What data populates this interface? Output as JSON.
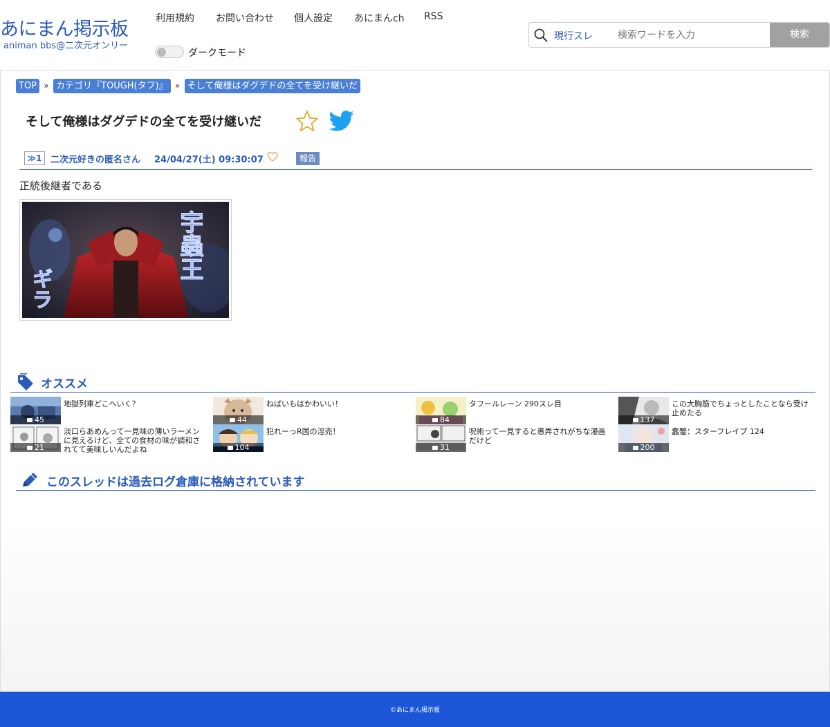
{
  "header": {
    "logo_main": "あにまん掲示板",
    "logo_sub": "animan bbs@二次元オンリー",
    "nav": [
      "利用規約",
      "お問い合わせ",
      "個人設定",
      "あにまんch",
      "RSS"
    ],
    "dark_mode_label": "ダークモード",
    "search": {
      "scope": "現行スレ",
      "placeholder": "検索ワードを入力",
      "button": "検索"
    }
  },
  "breadcrumb": [
    "TOP",
    "カテゴリ『TOUGH(タフ)』",
    "そして俺様はダグデドの全てを受け継いだ"
  ],
  "breadcrumb_separator": "»",
  "thread": {
    "title": "そして俺様はダグデドの全てを受け継いだ",
    "post": {
      "number": "≫1",
      "name": "二次元好きの匿名さん",
      "date": "24/04/27(土) 09:30:07",
      "report_label": "報告",
      "body": "正統後継者である",
      "image_text": {
        "left": "ギラ",
        "right": "宇蟲王"
      }
    }
  },
  "recommend": {
    "title": "オススメ",
    "items": [
      {
        "title": "地獄列車どこへいく？",
        "count": "45",
        "thumb": "thumb-1"
      },
      {
        "title": "ねばいもはかわいい！",
        "count": "44",
        "thumb": "thumb-2"
      },
      {
        "title": "タフールレーン 290スレ目",
        "count": "84",
        "thumb": "thumb-3"
      },
      {
        "title": "この大胸筋でちょっとしたことなら受け止めたる",
        "count": "137",
        "thumb": "thumb-4"
      },
      {
        "title": "淡口らあめんって一見味の薄いラーメンに見えるけど、全ての食材の味が調和されてて美味しいんだよね",
        "count": "21",
        "thumb": "thumb-5"
      },
      {
        "title": "犯れーっR国の淫売！",
        "count": "104",
        "thumb": "thumb-6"
      },
      {
        "title": "呪術って一見すると愚弄されがちな漫画だけど",
        "count": "31",
        "thumb": "thumb-7"
      },
      {
        "title": "蠢蟹：スターフレイプ 124",
        "count": "200",
        "thumb": "thumb-8"
      }
    ]
  },
  "archive": {
    "title": "このスレッドは過去ログ倉庫に格納されています"
  },
  "footer": {
    "copyright": "©あにまん掲示板"
  },
  "colors": {
    "accent": "#2a5bb8",
    "breadcrumb_bg": "#4a7fd6",
    "footer_bg": "#1a56d6",
    "search_button_bg": "#a1a1a1",
    "star": "#d9b33a",
    "twitter": "#1da1f2",
    "heart": "#e8a060"
  }
}
